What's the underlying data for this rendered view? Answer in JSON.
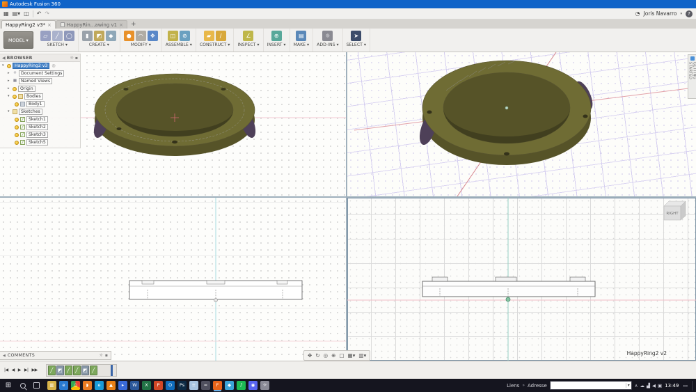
{
  "window": {
    "title": "Autodesk Fusion 360"
  },
  "appbar": {
    "user": "Joris Navarro"
  },
  "tabs": {
    "tab1": "HappyRing2 v3*",
    "tab2": "HappyRin...awing v1",
    "close": "×",
    "add": "+"
  },
  "ribbon": {
    "workspace": "MODEL ▾",
    "groups": [
      {
        "label": "SKETCH ▾",
        "icons": [
          {
            "name": "create-sketch-icon",
            "color": "#98a0c2",
            "glyph": "▱"
          },
          {
            "name": "line-tool-icon",
            "color": "#aab2cc",
            "glyph": "╱"
          },
          {
            "name": "circle-tool-icon",
            "color": "#8e98ba",
            "glyph": "◯"
          }
        ]
      },
      {
        "label": "CREATE ▾",
        "icons": [
          {
            "name": "new-body-icon",
            "color": "#9aa2aa",
            "glyph": "▮"
          },
          {
            "name": "extrude-icon",
            "color": "#c0a85a",
            "glyph": "◩"
          },
          {
            "name": "revolve-icon",
            "color": "#8fa8b8",
            "glyph": "◆"
          }
        ]
      },
      {
        "label": "MODIFY ▾",
        "icons": [
          {
            "name": "press-pull-icon",
            "color": "#e8912a",
            "glyph": "●"
          },
          {
            "name": "fillet-icon",
            "color": "#b0aca4",
            "glyph": "◠"
          },
          {
            "name": "move-icon",
            "color": "#5a88c8",
            "glyph": "✥"
          }
        ]
      },
      {
        "label": "ASSEMBLE ▾",
        "icons": [
          {
            "name": "new-component-icon",
            "color": "#c2b24a",
            "glyph": "◫"
          },
          {
            "name": "joint-icon",
            "color": "#6aa0c0",
            "glyph": "⊚"
          }
        ]
      },
      {
        "label": "CONSTRUCT ▾",
        "icons": [
          {
            "name": "offset-plane-icon",
            "color": "#e8b84a",
            "glyph": "▰"
          },
          {
            "name": "construction-axis-icon",
            "color": "#d8a83a",
            "glyph": "∕"
          }
        ]
      },
      {
        "label": "INSPECT ▾",
        "icons": [
          {
            "name": "measure-icon",
            "color": "#bfb74a",
            "glyph": "∠"
          }
        ]
      },
      {
        "label": "INSERT ▾",
        "icons": [
          {
            "name": "insert-icon",
            "color": "#58a89a",
            "glyph": "⊕"
          }
        ]
      },
      {
        "label": "MAKE ▾",
        "icons": [
          {
            "name": "print-3d-icon",
            "color": "#5a88b8",
            "glyph": "▤"
          }
        ]
      },
      {
        "label": "ADD-INS ▾",
        "icons": [
          {
            "name": "scripts-addins-icon",
            "color": "#8a8a92",
            "glyph": "☼"
          }
        ]
      },
      {
        "label": "SELECT ▾",
        "icons": [
          {
            "name": "select-icon",
            "color": "#3c4c6a",
            "glyph": "➤"
          }
        ]
      }
    ]
  },
  "browser": {
    "title": "BROWSER",
    "root": "HappyRing2 v3",
    "items": {
      "doc_settings": "Document Settings",
      "named_views": "Named Views",
      "origin": "Origin",
      "bodies": "Bodies",
      "body1": "Body1",
      "sketches": "Sketches",
      "sketch1": "Sketch1",
      "sketch2": "Sketch2",
      "sketch3": "Sketch3",
      "sketch5": "Sketch5"
    }
  },
  "panels": {
    "comments": "COMMENTS",
    "getting_started": "GETTING STARTED"
  },
  "viewports": {
    "viewcube_face": "RIGHT",
    "bottom_right_label": "HappyRing2 v2"
  },
  "navbar": {
    "icons": [
      {
        "name": "pan-icon",
        "glyph": "✥"
      },
      {
        "name": "orbit-icon",
        "glyph": "↻"
      },
      {
        "name": "look-at-icon",
        "glyph": "◎"
      },
      {
        "name": "zoom-icon",
        "glyph": "⊕"
      },
      {
        "name": "fit-icon",
        "glyph": "▢"
      },
      {
        "name": "display-settings-icon",
        "glyph": "▦▾"
      },
      {
        "name": "viewport-layout-icon",
        "glyph": "▥▾"
      }
    ]
  },
  "timeline": {
    "playback": [
      {
        "name": "go-to-start-button",
        "glyph": "|◀"
      },
      {
        "name": "step-back-button",
        "glyph": "◀"
      },
      {
        "name": "play-button",
        "glyph": "▶"
      },
      {
        "name": "step-forward-button",
        "glyph": "▶|"
      },
      {
        "name": "go-to-end-button",
        "glyph": "▶▶"
      }
    ],
    "features": [
      {
        "name": "sketch1-feature-icon",
        "color": "#7da85c",
        "glyph": "╱"
      },
      {
        "name": "extrude1-feature-icon",
        "color": "#8898a8",
        "glyph": "◩"
      },
      {
        "name": "sketch2-feature-icon",
        "color": "#7da85c",
        "glyph": "╱"
      },
      {
        "name": "sketch3-feature-icon",
        "color": "#7da85c",
        "glyph": "╱"
      },
      {
        "name": "extrude2-feature-icon",
        "color": "#8898a8",
        "glyph": "◩"
      },
      {
        "name": "sketch5-feature-icon",
        "color": "#7da85c",
        "glyph": "╱"
      }
    ]
  },
  "taskbar": {
    "links_label": "Liens",
    "links_chevron": "»",
    "address_label": "Adresse",
    "address_value": "",
    "time": "13:49",
    "apps": [
      {
        "name": "file-explorer-icon",
        "color": "#d8b44a",
        "glyph": "▥"
      },
      {
        "name": "internet-explorer-icon",
        "color": "#2a7ad0",
        "glyph": "e"
      },
      {
        "name": "chrome-icon",
        "color": "conic-gradient(#ea4335 0 33%,#fbbc05 0 66%,#34a853 0)",
        "glyph": "○"
      },
      {
        "name": "firefox-icon",
        "color": "#e87a22",
        "glyph": "◗"
      },
      {
        "name": "edge-icon",
        "color": "#1a9ad8",
        "glyph": "e"
      },
      {
        "name": "vlc-icon",
        "color": "#e87f18",
        "glyph": "▲"
      },
      {
        "name": "media-player-icon",
        "color": "#3a6ad8",
        "glyph": "▸"
      },
      {
        "name": "word-icon",
        "color": "#2b579a",
        "glyph": "W"
      },
      {
        "name": "excel-icon",
        "color": "#217346",
        "glyph": "X"
      },
      {
        "name": "powerpoint-icon",
        "color": "#d24726",
        "glyph": "P"
      },
      {
        "name": "outlook-icon",
        "color": "#0f6cbd",
        "glyph": "O"
      },
      {
        "name": "photoshop-icon",
        "color": "#0d2a44",
        "glyph": "Ps"
      },
      {
        "name": "notepad-icon",
        "color": "#a8c4e0",
        "glyph": "≡"
      },
      {
        "name": "calculator-icon",
        "color": "#50505e",
        "glyph": "="
      },
      {
        "name": "fusion360-icon",
        "color": "#e8641a",
        "glyph": "F",
        "active": true
      },
      {
        "name": "slicer-icon",
        "color": "#3aa4d8",
        "glyph": "◆"
      },
      {
        "name": "spotify-icon",
        "color": "#1db954",
        "glyph": "♪"
      },
      {
        "name": "discord-icon",
        "color": "#5865f2",
        "glyph": "◉"
      },
      {
        "name": "settings-icon",
        "color": "#8a8a96",
        "glyph": "☼"
      }
    ],
    "tray": [
      {
        "name": "tray-chevron-up-icon",
        "glyph": "∧"
      },
      {
        "name": "onedrive-icon",
        "glyph": "☁"
      },
      {
        "name": "network-icon",
        "glyph": "▟"
      },
      {
        "name": "volume-icon",
        "glyph": "◀"
      },
      {
        "name": "input-indicator-icon",
        "glyph": "▣"
      }
    ]
  },
  "colors": {
    "titlebar_blue": "#0f63c8",
    "ring_olive": "#6f6c34",
    "ring_side": "#565328",
    "shade_purple": "#4e4058",
    "grid_lavender": "#d5cef0",
    "axis_red": "#e2a0a8",
    "axis_teal": "#96d0c4",
    "selection_blue": "#4a86c8"
  }
}
